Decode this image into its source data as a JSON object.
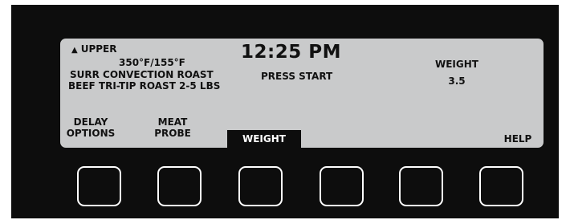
{
  "display": {
    "oven_indicator": "UPPER",
    "oven_indicator_icon": "triangle-up-icon",
    "temperature": "350°F/155°F",
    "cook_mode": "SURR CONVECTION ROAST",
    "recipe": "BEEF TRI-TIP ROAST 2-5 LBS",
    "clock": "12:25 PM",
    "prompt": "PRESS START",
    "weight_label": "WEIGHT",
    "weight_value": "3.5"
  },
  "softkeys": [
    {
      "line1": "DELAY",
      "line2": "OPTIONS",
      "active": false
    },
    {
      "line1": "MEAT",
      "line2": "PROBE",
      "active": false
    },
    {
      "line1": "",
      "line2": "WEIGHT",
      "active": true
    },
    {
      "line1": "",
      "line2": "",
      "active": false
    },
    {
      "line1": "",
      "line2": "",
      "active": false
    },
    {
      "line1": "",
      "line2": "HELP",
      "active": false
    }
  ],
  "colors": {
    "bezel": "#0d0d0d",
    "lcd_background": "#c9cacb",
    "lcd_text": "#111111",
    "button_border": "#ffffff"
  }
}
